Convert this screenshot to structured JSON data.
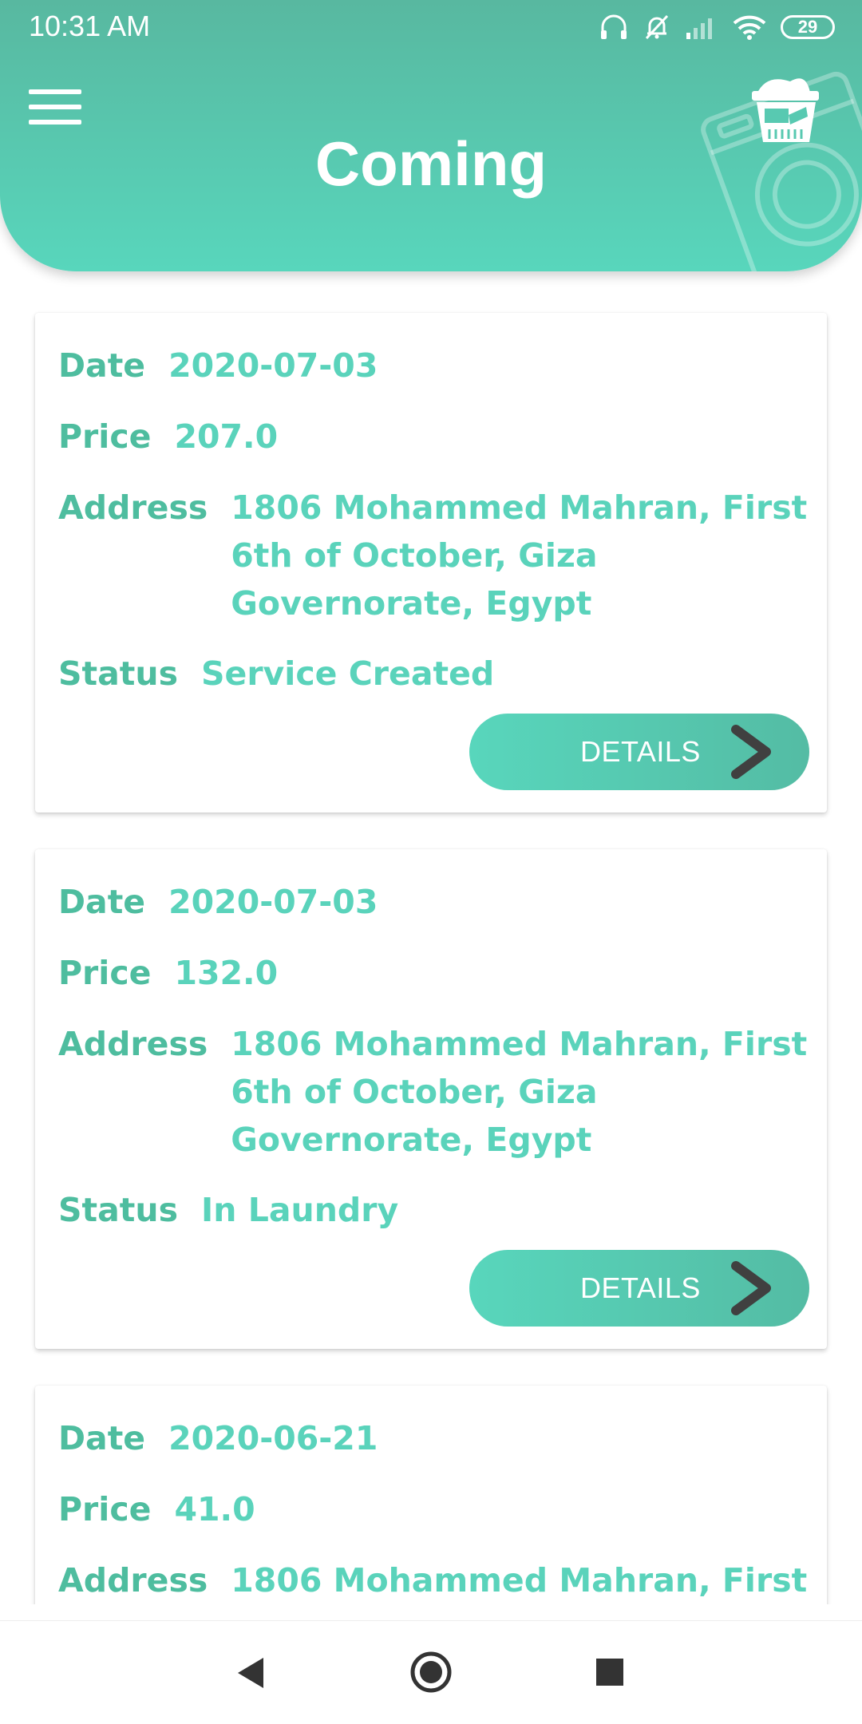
{
  "status_bar": {
    "time": "10:31 AM",
    "battery": "29",
    "icons": [
      "headset-icon",
      "bell-off-icon",
      "signal-icon",
      "wifi-icon",
      "battery-icon"
    ]
  },
  "header": {
    "title": "Coming",
    "menu_icon": "hamburger-menu-icon",
    "logo_icon": "washing-machine-basket-icon"
  },
  "labels": {
    "date": "Date",
    "price": "Price",
    "address": "Address",
    "status": "Status",
    "details": "DETAILS"
  },
  "orders": [
    {
      "date": "2020-07-03",
      "price": "207.0",
      "address": "1806 Mohammed Mahran, First 6th of October, Giza Governorate, Egypt",
      "status": "Service Created"
    },
    {
      "date": "2020-07-03",
      "price": "132.0",
      "address": "1806 Mohammed Mahran, First 6th of October, Giza Governorate, Egypt",
      "status": "In Laundry"
    },
    {
      "date": "2020-06-21",
      "price": "41.0",
      "address": "1806 Mohammed Mahran, First"
    }
  ],
  "nav_bar": {
    "icons": [
      "back-triangle-icon",
      "home-circle-icon",
      "recents-square-icon"
    ]
  },
  "colors": {
    "accent": "#58d6bc",
    "label": "#4ebd9f",
    "value": "#5ad3bb",
    "chevron": "#404040"
  }
}
